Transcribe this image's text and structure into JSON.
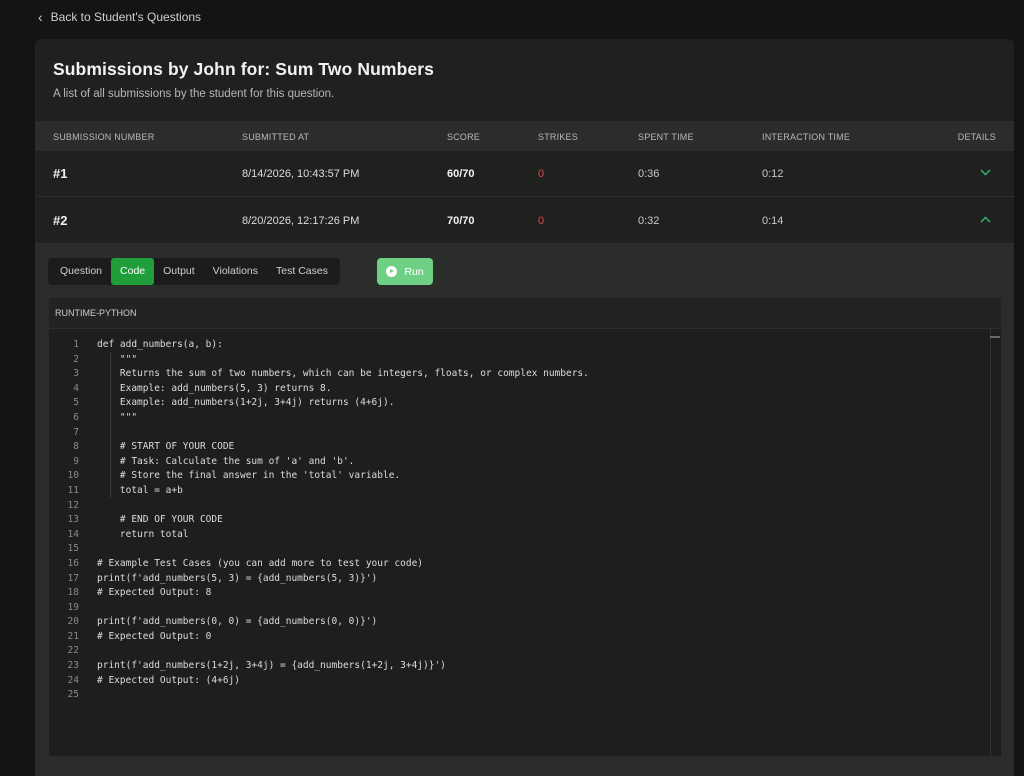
{
  "back_link": "Back to Student's Questions",
  "panel": {
    "title": "Submissions by John for: Sum Two Numbers",
    "subtitle": "A list of all submissions by the student for this question."
  },
  "table": {
    "headers": {
      "submission_number": "SUBMISSION NUMBER",
      "submitted_at": "SUBMITTED AT",
      "score": "SCORE",
      "strikes": "STRIKES",
      "spent_time": "SPENT TIME",
      "interaction_time": "INTERACTION TIME",
      "details": "DETAILS"
    },
    "rows": [
      {
        "number": "#1",
        "submitted_at": "8/14/2026, 10:43:57 PM",
        "score": "60/70",
        "strikes": "0",
        "spent_time": "0:36",
        "interaction_time": "0:12",
        "expanded": false
      },
      {
        "number": "#2",
        "submitted_at": "8/20/2026, 12:17:26 PM",
        "score": "70/70",
        "strikes": "0",
        "spent_time": "0:32",
        "interaction_time": "0:14",
        "expanded": true
      }
    ]
  },
  "tabs": [
    "Question",
    "Code",
    "Output",
    "Violations",
    "Test Cases"
  ],
  "active_tab": "Code",
  "run_label": "Run",
  "editor": {
    "runtime_label": "RUNTIME-PYTHON",
    "lines": [
      "def add_numbers(a, b):",
      "    \"\"\"",
      "    Returns the sum of two numbers, which can be integers, floats, or complex numbers.",
      "    Example: add_numbers(5, 3) returns 8.",
      "    Example: add_numbers(1+2j, 3+4j) returns (4+6j).",
      "    \"\"\"",
      "",
      "    # START OF YOUR CODE",
      "    # Task: Calculate the sum of 'a' and 'b'.",
      "    # Store the final answer in the 'total' variable.",
      "    total = a+b",
      "",
      "    # END OF YOUR CODE",
      "    return total",
      "",
      "# Example Test Cases (you can add more to test your code)",
      "print(f'add_numbers(5, 3) = {add_numbers(5, 3)}')",
      "# Expected Output: 8",
      "",
      "print(f'add_numbers(0, 0) = {add_numbers(0, 0)}')",
      "# Expected Output: 0",
      "",
      "print(f'add_numbers(1+2j, 3+4j) = {add_numbers(1+2j, 3+4j)}')",
      "# Expected Output: (4+6j)",
      ""
    ]
  },
  "colors": {
    "accent_green": "#1f9e3a",
    "run_green": "#6fcf84",
    "chevron_green": "#2ebd6b",
    "strike_red": "#e04848"
  }
}
